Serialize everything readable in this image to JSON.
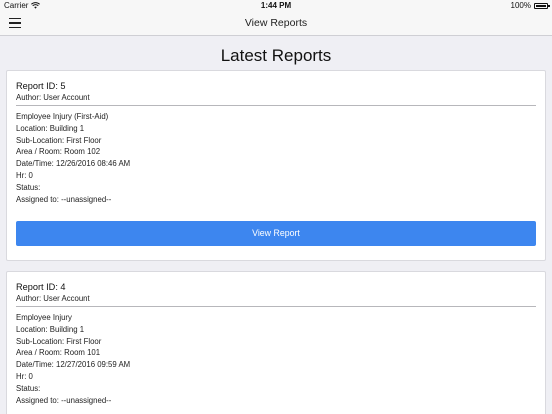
{
  "status_bar": {
    "carrier": "Carrier",
    "time": "1:44 PM",
    "battery": "100%",
    "battery_level": 1.0
  },
  "nav": {
    "title": "View Reports"
  },
  "page": {
    "title": "Latest Reports"
  },
  "reports": [
    {
      "id": "Report ID: 5",
      "author": "Author: User Account",
      "type": "Employee Injury (First-Aid)",
      "location": "Location: Building 1",
      "sub_location": "Sub-Location: First Floor",
      "area_room": "Area / Room: Room 102",
      "datetime": "Date/Time: 12/26/2016 08:46 AM",
      "hr": "Hr: 0",
      "status": "Status:",
      "assigned": "Assigned to: --unassigned--",
      "button_label": "View Report"
    },
    {
      "id": "Report ID: 4",
      "author": "Author: User Account",
      "type": "Employee Injury",
      "location": "Location: Building 1",
      "sub_location": "Sub-Location: First Floor",
      "area_room": "Area / Room: Room 101",
      "datetime": "Date/Time: 12/27/2016 09:59 AM",
      "hr": "Hr: 0",
      "status": "Status:",
      "assigned": "Assigned to: --unassigned--"
    }
  ]
}
